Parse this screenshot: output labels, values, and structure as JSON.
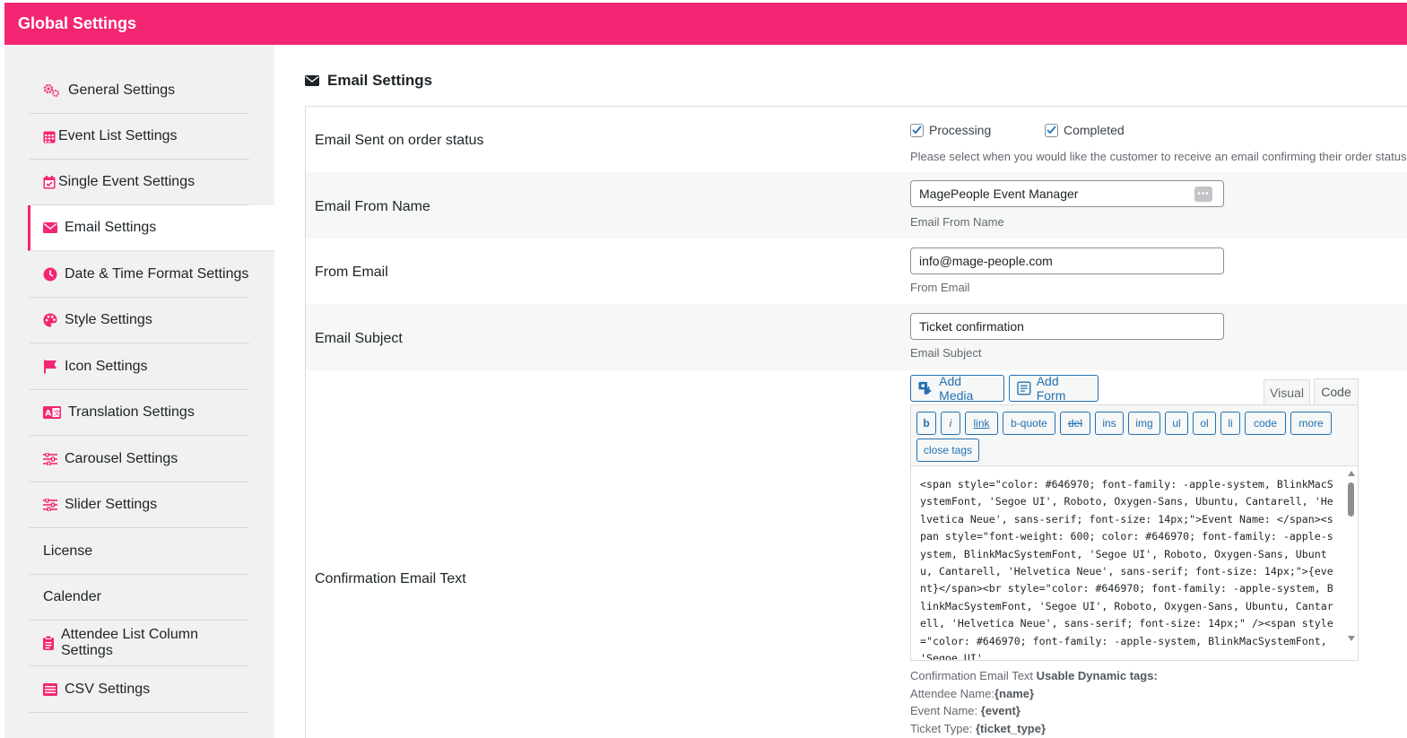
{
  "header": {
    "title": "Global Settings"
  },
  "colors": {
    "accent": "#f42673",
    "link": "#2271b1"
  },
  "sidebar": {
    "items": [
      {
        "label": "General Settings",
        "icon": "gears-icon"
      },
      {
        "label": "Event List Settings",
        "icon": "calendar-grid-icon"
      },
      {
        "label": "Single Event Settings",
        "icon": "calendar-check-icon"
      },
      {
        "label": "Email Settings",
        "icon": "envelope-icon",
        "active": true
      },
      {
        "label": "Date & Time Format Settings",
        "icon": "clock-icon"
      },
      {
        "label": "Style Settings",
        "icon": "palette-icon"
      },
      {
        "label": "Icon Settings",
        "icon": "flag-icon"
      },
      {
        "label": "Translation Settings",
        "icon": "language-icon"
      },
      {
        "label": "Carousel Settings",
        "icon": "sliders-icon"
      },
      {
        "label": "Slider Settings",
        "icon": "sliders-icon"
      },
      {
        "label": "License",
        "icon": ""
      },
      {
        "label": "Calender",
        "icon": ""
      },
      {
        "label": "Attendee List Column Settings",
        "icon": "clipboard-icon"
      },
      {
        "label": "CSV Settings",
        "icon": "list-icon"
      }
    ]
  },
  "main": {
    "section_title": "Email Settings",
    "order_status": {
      "label": "Email Sent on order status",
      "options": [
        {
          "label": "Processing",
          "checked": true
        },
        {
          "label": "Completed",
          "checked": true
        }
      ],
      "description": "Please select when you would like the customer to receive an email confirming their order status"
    },
    "from_name": {
      "label": "Email From Name",
      "value": "MagePeople Event Manager",
      "description": "Email From Name"
    },
    "from_email": {
      "label": "From Email",
      "value": "info@mage-people.com",
      "description": "From Email"
    },
    "subject": {
      "label": "Email Subject",
      "value": "Ticket confirmation",
      "description": "Email Subject"
    },
    "confirmation": {
      "label": "Confirmation Email Text",
      "add_media": "Add Media",
      "add_form": "Add Form",
      "tab_visual": "Visual",
      "tab_code": "Code",
      "quicktags": [
        "b",
        "i",
        "link",
        "b-quote",
        "del",
        "ins",
        "img",
        "ul",
        "ol",
        "li",
        "code",
        "more",
        "close tags"
      ],
      "content": "<span style=\"color: #646970; font-family: -apple-system, BlinkMacSystemFont, 'Segoe UI', Roboto, Oxygen-Sans, Ubuntu, Cantarell, 'Helvetica Neue', sans-serif; font-size: 14px;\">Event Name: </span><span style=\"font-weight: 600; color: #646970; font-family: -apple-system, BlinkMacSystemFont, 'Segoe UI', Roboto, Oxygen-Sans, Ubuntu, Cantarell, 'Helvetica Neue', sans-serif; font-size: 14px;\">{event}</span><br style=\"color: #646970; font-family: -apple-system, BlinkMacSystemFont, 'Segoe UI', Roboto, Oxygen-Sans, Ubuntu, Cantarell, 'Helvetica Neue', sans-serif; font-size: 14px;\" /><span style=\"color: #646970; font-family: -apple-system, BlinkMacSystemFont, 'Segoe UI'",
      "tags_prefix": "Confirmation Email Text",
      "tags_title": "Usable Dynamic tags:",
      "tags": [
        {
          "label": "Attendee Name:",
          "tag": "{name}"
        },
        {
          "label": "Event Name:",
          "tag": "{event}"
        },
        {
          "label": "Ticket Type:",
          "tag": "{ticket_type}"
        }
      ]
    }
  }
}
